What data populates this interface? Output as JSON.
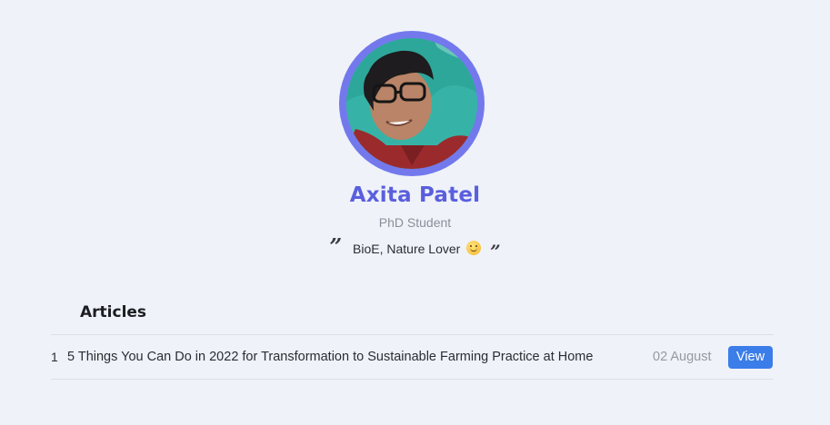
{
  "profile": {
    "name": "Axita Patel",
    "role": "PhD Student",
    "bio": "BioE, Nature Lover",
    "bio_emoji": "smiling-face-emoji",
    "quote_open": "”",
    "quote_close": "”"
  },
  "articles": {
    "heading": "Articles",
    "rows": [
      {
        "index": "1",
        "title": "5 Things You Can Do in 2022 for Transformation to Sustainable Farming Practice at Home",
        "date": "02 August",
        "action_label": "View"
      }
    ]
  },
  "colors": {
    "background": "#eff2f8",
    "accent": "#5a5fde",
    "avatar_ring": "#7379ec",
    "button": "#3b7de9"
  }
}
